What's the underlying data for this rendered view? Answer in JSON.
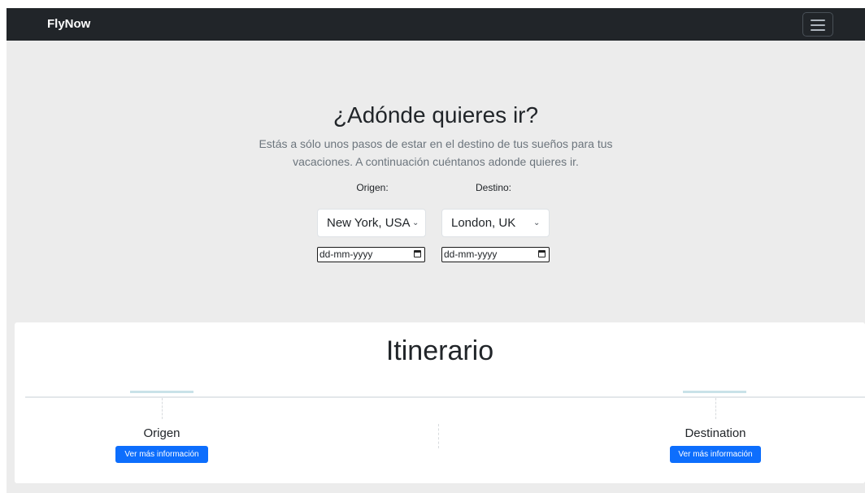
{
  "navbar": {
    "brand": "FlyNow",
    "toggler_icon": "hamburger-menu-icon"
  },
  "hero": {
    "title": "¿Adónde quieres ir?",
    "description": "Estás a sólo unos pasos de estar en el destino de tus sueños para tus vacaciones. A continuación cuéntanos adonde quieres ir."
  },
  "form": {
    "origin_label": "Origen:",
    "destination_label": "Destino:",
    "origin_value": "New York, USA",
    "destination_value": "London, UK",
    "origin_date_placeholder": "dd-mm-yyyy",
    "destination_date_placeholder": "dd-mm-yyyy",
    "calendar_icon": "calendar-icon",
    "dropdown_icon": "chevron-down-icon"
  },
  "itinerary": {
    "title": "Itinerario",
    "origin_label": "Origen",
    "destination_label": "Destination",
    "origin_button": "Ver más información",
    "destination_button": "Ver más información"
  },
  "colors": {
    "navbar_bg": "#212529",
    "page_bg": "#ececec",
    "primary_button": "#0d6efd",
    "accent_line": "#c9e2e8"
  }
}
